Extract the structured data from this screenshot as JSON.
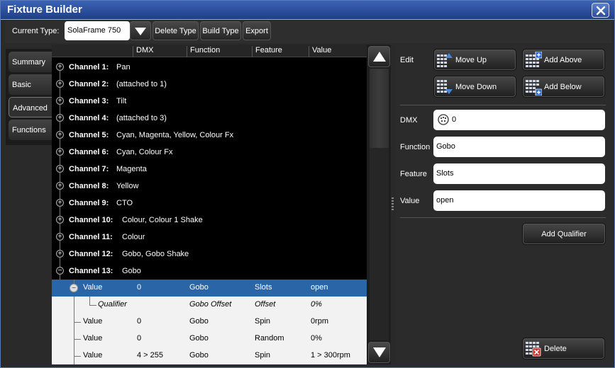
{
  "window": {
    "title": "Fixture Builder"
  },
  "toolbar": {
    "current_type_label": "Current Type:",
    "current_type_value": "SolaFrame 750",
    "delete_type": "Delete Type",
    "build_type": "Build Type",
    "export": "Export"
  },
  "tabs": [
    {
      "label": "Summary",
      "active": false
    },
    {
      "label": "Basic",
      "active": false
    },
    {
      "label": "Advanced",
      "active": true
    },
    {
      "label": "Functions",
      "active": false
    }
  ],
  "list": {
    "headers": [
      "DMX",
      "Function",
      "Feature",
      "Value"
    ],
    "channels": [
      {
        "name": "Channel 1:",
        "value": "Pan",
        "expanded": false
      },
      {
        "name": "Channel 2:",
        "value": "(attached to 1)",
        "expanded": false
      },
      {
        "name": "Channel 3:",
        "value": "Tilt",
        "expanded": false
      },
      {
        "name": "Channel 4:",
        "value": "(attached to 3)",
        "expanded": false
      },
      {
        "name": "Channel 5:",
        "value": "Cyan, Magenta, Yellow, Colour Fx",
        "expanded": false
      },
      {
        "name": "Channel 6:",
        "value": "Cyan, Colour Fx",
        "expanded": false
      },
      {
        "name": "Channel 7:",
        "value": "Magenta",
        "expanded": false
      },
      {
        "name": "Channel 8:",
        "value": "Yellow",
        "expanded": false
      },
      {
        "name": "Channel 9:",
        "value": "CTO",
        "expanded": false
      },
      {
        "name": "Channel 10:",
        "value": "Colour, Colour 1 Shake",
        "expanded": false
      },
      {
        "name": "Channel 11:",
        "value": "Colour",
        "expanded": false
      },
      {
        "name": "Channel 12:",
        "value": "Gobo, Gobo Shake",
        "expanded": false
      },
      {
        "name": "Channel 13:",
        "value": "Gobo",
        "expanded": true
      }
    ],
    "subrows": [
      {
        "type": "Value",
        "dmx": "0",
        "function": "Gobo",
        "feature": "Slots",
        "value": "open",
        "selected": true,
        "italic": false
      },
      {
        "type": "Qualifier",
        "dmx": "",
        "function": "Gobo Offset",
        "feature": "Offset",
        "value": "0%",
        "selected": false,
        "italic": true
      },
      {
        "type": "Value",
        "dmx": "0",
        "function": "Gobo",
        "feature": "Spin",
        "value": "0rpm",
        "selected": false,
        "italic": false
      },
      {
        "type": "Value",
        "dmx": "0",
        "function": "Gobo",
        "feature": "Random",
        "value": "0%",
        "selected": false,
        "italic": false
      },
      {
        "type": "Value",
        "dmx": "4 > 255",
        "function": "Gobo",
        "feature": "Spin",
        "value": "1 > 300rpm",
        "selected": false,
        "italic": false
      }
    ]
  },
  "edit": {
    "label": "Edit",
    "move_up": "Move Up",
    "add_above": "Add Above",
    "move_down": "Move Down",
    "add_below": "Add Below"
  },
  "properties": {
    "dmx_label": "DMX",
    "dmx_value": "0",
    "function_label": "Function",
    "function_value": "Gobo",
    "feature_label": "Feature",
    "feature_value": "Slots",
    "value_label": "Value",
    "value_value": "open"
  },
  "actions": {
    "add_qualifier": "Add Qualifier",
    "delete": "Delete"
  },
  "colors": {
    "title_bar": "#2b4f9e",
    "selection": "#2a65a8",
    "delete_accent": "#d22b2b"
  },
  "icons": [
    "close-icon",
    "dropdown-arrow-icon",
    "scroll-up-icon",
    "scroll-down-icon",
    "move-up-icon",
    "move-down-icon",
    "add-above-icon",
    "add-below-icon",
    "dmx-connector-icon",
    "delete-icon",
    "expand-icon",
    "collapse-icon"
  ]
}
